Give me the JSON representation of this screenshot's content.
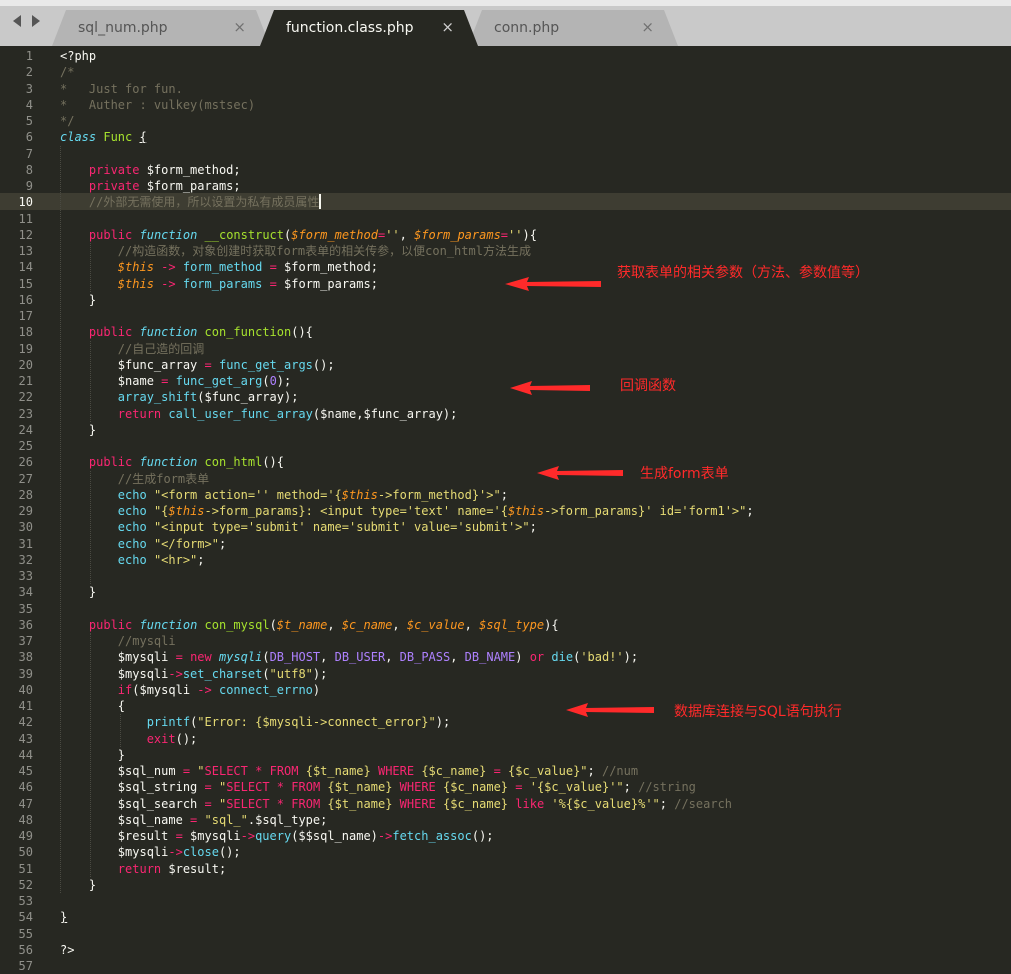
{
  "tabs": [
    {
      "label": "sql_num.php",
      "close": "×",
      "active": false
    },
    {
      "label": "function.class.php",
      "close": "×",
      "active": true
    },
    {
      "label": "conn.php",
      "close": "×",
      "active": false
    }
  ],
  "editor": {
    "current_line": 10,
    "lines": [
      [
        [
          "p",
          "<?php"
        ]
      ],
      [
        [
          "c",
          "/*"
        ]
      ],
      [
        [
          "c",
          "*   Just for fun."
        ]
      ],
      [
        [
          "c",
          "*   Auther : vulkey(mstsec)"
        ]
      ],
      [
        [
          "c",
          "*/"
        ]
      ],
      [
        [
          "st",
          "class"
        ],
        [
          "p",
          " "
        ],
        [
          "f",
          "Func"
        ],
        [
          "p",
          " "
        ],
        [
          "pu",
          "{"
        ]
      ],
      [],
      [
        [
          "p",
          "    "
        ],
        [
          "k",
          "private"
        ],
        [
          "p",
          " $form_method;"
        ]
      ],
      [
        [
          "p",
          "    "
        ],
        [
          "k",
          "private"
        ],
        [
          "p",
          " $form_params;"
        ]
      ],
      [
        [
          "p",
          "    "
        ],
        [
          "c",
          "//外部无需使用，所以设置为私有成员属性"
        ]
      ],
      [],
      [
        [
          "p",
          "    "
        ],
        [
          "k",
          "public"
        ],
        [
          "p",
          " "
        ],
        [
          "st",
          "function"
        ],
        [
          "p",
          " "
        ],
        [
          "f",
          "__construct"
        ],
        [
          "p",
          "("
        ],
        [
          "t",
          "$form_method"
        ],
        [
          "k",
          "="
        ],
        [
          "s",
          "''"
        ],
        [
          "p",
          ", "
        ],
        [
          "t",
          "$form_params"
        ],
        [
          "k",
          "="
        ],
        [
          "s",
          "''"
        ],
        [
          "p",
          "){"
        ]
      ],
      [
        [
          "p",
          "        "
        ],
        [
          "c",
          "//构造函数，对象创建时获取form表单的相关传参，以便con_html方法生成"
        ]
      ],
      [
        [
          "p",
          "        "
        ],
        [
          "t",
          "$this"
        ],
        [
          "p",
          " "
        ],
        [
          "k",
          "->"
        ],
        [
          "p",
          " "
        ],
        [
          "m",
          "form_method"
        ],
        [
          "p",
          " "
        ],
        [
          "k",
          "="
        ],
        [
          "p",
          " $form_method;"
        ]
      ],
      [
        [
          "p",
          "        "
        ],
        [
          "t",
          "$this"
        ],
        [
          "p",
          " "
        ],
        [
          "k",
          "->"
        ],
        [
          "p",
          " "
        ],
        [
          "m",
          "form_params"
        ],
        [
          "p",
          " "
        ],
        [
          "k",
          "="
        ],
        [
          "p",
          " $form_params;"
        ]
      ],
      [
        [
          "p",
          "    }"
        ]
      ],
      [],
      [
        [
          "p",
          "    "
        ],
        [
          "k",
          "public"
        ],
        [
          "p",
          " "
        ],
        [
          "st",
          "function"
        ],
        [
          "p",
          " "
        ],
        [
          "f",
          "con_function"
        ],
        [
          "p",
          "(){"
        ]
      ],
      [
        [
          "p",
          "        "
        ],
        [
          "c",
          "//自己造的回调"
        ]
      ],
      [
        [
          "p",
          "        $func_array "
        ],
        [
          "k",
          "="
        ],
        [
          "p",
          " "
        ],
        [
          "m",
          "func_get_args"
        ],
        [
          "p",
          "();"
        ]
      ],
      [
        [
          "p",
          "        $name "
        ],
        [
          "k",
          "="
        ],
        [
          "p",
          " "
        ],
        [
          "m",
          "func_get_arg"
        ],
        [
          "p",
          "("
        ],
        [
          "n",
          "0"
        ],
        [
          "p",
          ");"
        ]
      ],
      [
        [
          "p",
          "        "
        ],
        [
          "m",
          "array_shift"
        ],
        [
          "p",
          "($func_array);"
        ]
      ],
      [
        [
          "p",
          "        "
        ],
        [
          "k",
          "return"
        ],
        [
          "p",
          " "
        ],
        [
          "m",
          "call_user_func_array"
        ],
        [
          "p",
          "($name,$func_array);"
        ]
      ],
      [
        [
          "p",
          "    }"
        ]
      ],
      [],
      [
        [
          "p",
          "    "
        ],
        [
          "k",
          "public"
        ],
        [
          "p",
          " "
        ],
        [
          "st",
          "function"
        ],
        [
          "p",
          " "
        ],
        [
          "f",
          "con_html"
        ],
        [
          "p",
          "(){"
        ]
      ],
      [
        [
          "p",
          "        "
        ],
        [
          "c",
          "//生成form表单"
        ]
      ],
      [
        [
          "p",
          "        "
        ],
        [
          "m",
          "echo"
        ],
        [
          "p",
          " "
        ],
        [
          "s",
          "\"<form action='' method='{"
        ],
        [
          "t",
          "$this"
        ],
        [
          "s",
          "->form_method}'>\""
        ],
        [
          "p",
          ";"
        ]
      ],
      [
        [
          "p",
          "        "
        ],
        [
          "m",
          "echo"
        ],
        [
          "p",
          " "
        ],
        [
          "s",
          "\"{"
        ],
        [
          "t",
          "$this"
        ],
        [
          "s",
          "->form_params}: <input type='text' name='{"
        ],
        [
          "t",
          "$this"
        ],
        [
          "s",
          "->form_params}' id='form1'>\""
        ],
        [
          "p",
          ";"
        ]
      ],
      [
        [
          "p",
          "        "
        ],
        [
          "m",
          "echo"
        ],
        [
          "p",
          " "
        ],
        [
          "s",
          "\"<input type='submit' name='submit' value='submit'>\""
        ],
        [
          "p",
          ";"
        ]
      ],
      [
        [
          "p",
          "        "
        ],
        [
          "m",
          "echo"
        ],
        [
          "p",
          " "
        ],
        [
          "s",
          "\"</form>\""
        ],
        [
          "p",
          ";"
        ]
      ],
      [
        [
          "p",
          "        "
        ],
        [
          "m",
          "echo"
        ],
        [
          "p",
          " "
        ],
        [
          "s",
          "\"<hr>\""
        ],
        [
          "p",
          ";"
        ]
      ],
      [],
      [
        [
          "p",
          "    }"
        ]
      ],
      [],
      [
        [
          "p",
          "    "
        ],
        [
          "k",
          "public"
        ],
        [
          "p",
          " "
        ],
        [
          "st",
          "function"
        ],
        [
          "p",
          " "
        ],
        [
          "f",
          "con_mysql"
        ],
        [
          "p",
          "("
        ],
        [
          "t",
          "$t_name"
        ],
        [
          "p",
          ", "
        ],
        [
          "t",
          "$c_name"
        ],
        [
          "p",
          ", "
        ],
        [
          "t",
          "$c_value"
        ],
        [
          "p",
          ", "
        ],
        [
          "t",
          "$sql_type"
        ],
        [
          "p",
          "){"
        ]
      ],
      [
        [
          "p",
          "        "
        ],
        [
          "c",
          "//mysqli"
        ]
      ],
      [
        [
          "p",
          "        $mysqli "
        ],
        [
          "k",
          "="
        ],
        [
          "p",
          " "
        ],
        [
          "k",
          "new"
        ],
        [
          "p",
          " "
        ],
        [
          "st",
          "mysqli"
        ],
        [
          "p",
          "("
        ],
        [
          "cn",
          "DB_HOST"
        ],
        [
          "p",
          ", "
        ],
        [
          "cn",
          "DB_USER"
        ],
        [
          "p",
          ", "
        ],
        [
          "cn",
          "DB_PASS"
        ],
        [
          "p",
          ", "
        ],
        [
          "cn",
          "DB_NAME"
        ],
        [
          "p",
          ") "
        ],
        [
          "k",
          "or"
        ],
        [
          "p",
          " "
        ],
        [
          "m",
          "die"
        ],
        [
          "p",
          "("
        ],
        [
          "s",
          "'bad!'"
        ],
        [
          "p",
          ");"
        ]
      ],
      [
        [
          "p",
          "        $mysqli"
        ],
        [
          "k",
          "->"
        ],
        [
          "m",
          "set_charset"
        ],
        [
          "p",
          "("
        ],
        [
          "s",
          "\"utf8\""
        ],
        [
          "p",
          ");"
        ]
      ],
      [
        [
          "p",
          "        "
        ],
        [
          "k",
          "if"
        ],
        [
          "p",
          "($mysqli "
        ],
        [
          "k",
          "->"
        ],
        [
          "p",
          " "
        ],
        [
          "m",
          "connect_errno"
        ],
        [
          "p",
          ")"
        ]
      ],
      [
        [
          "p",
          "        {"
        ]
      ],
      [
        [
          "p",
          "            "
        ],
        [
          "m",
          "printf"
        ],
        [
          "p",
          "("
        ],
        [
          "s",
          "\"Error: {$mysqli->connect_error}\""
        ],
        [
          "p",
          ");"
        ]
      ],
      [
        [
          "p",
          "            "
        ],
        [
          "k",
          "exit"
        ],
        [
          "p",
          "();"
        ]
      ],
      [
        [
          "p",
          "        }"
        ]
      ],
      [
        [
          "p",
          "        $sql_num "
        ],
        [
          "k",
          "="
        ],
        [
          "p",
          " "
        ],
        [
          "s",
          "\""
        ],
        [
          "k",
          "SELECT"
        ],
        [
          "s",
          " "
        ],
        [
          "k",
          "*"
        ],
        [
          "s",
          " "
        ],
        [
          "k",
          "FROM"
        ],
        [
          "s",
          " {$t_name} "
        ],
        [
          "k",
          "WHERE"
        ],
        [
          "s",
          " {$c_name} "
        ],
        [
          "k",
          "="
        ],
        [
          "s",
          " {$c_value}\""
        ],
        [
          "p",
          "; "
        ],
        [
          "c",
          "//num"
        ]
      ],
      [
        [
          "p",
          "        $sql_string "
        ],
        [
          "k",
          "="
        ],
        [
          "p",
          " "
        ],
        [
          "s",
          "\""
        ],
        [
          "k",
          "SELECT"
        ],
        [
          "s",
          " "
        ],
        [
          "k",
          "*"
        ],
        [
          "s",
          " "
        ],
        [
          "k",
          "FROM"
        ],
        [
          "s",
          " {$t_name} "
        ],
        [
          "k",
          "WHERE"
        ],
        [
          "s",
          " {$c_name} "
        ],
        [
          "k",
          "="
        ],
        [
          "s",
          " '{$c_value}'\""
        ],
        [
          "p",
          "; "
        ],
        [
          "c",
          "//string"
        ]
      ],
      [
        [
          "p",
          "        $sql_search "
        ],
        [
          "k",
          "="
        ],
        [
          "p",
          " "
        ],
        [
          "s",
          "\""
        ],
        [
          "k",
          "SELECT"
        ],
        [
          "s",
          " "
        ],
        [
          "k",
          "*"
        ],
        [
          "s",
          " "
        ],
        [
          "k",
          "FROM"
        ],
        [
          "s",
          " {$t_name} "
        ],
        [
          "k",
          "WHERE"
        ],
        [
          "s",
          " {$c_name} "
        ],
        [
          "k",
          "like"
        ],
        [
          "s",
          " '%{$c_value}%'\""
        ],
        [
          "p",
          "; "
        ],
        [
          "c",
          "//search"
        ]
      ],
      [
        [
          "p",
          "        $sql_name "
        ],
        [
          "k",
          "="
        ],
        [
          "p",
          " "
        ],
        [
          "s",
          "\"sql_\""
        ],
        [
          "p",
          "."
        ],
        [
          "p",
          "$sql_type;"
        ]
      ],
      [
        [
          "p",
          "        $result "
        ],
        [
          "k",
          "="
        ],
        [
          "p",
          " $mysqli"
        ],
        [
          "k",
          "->"
        ],
        [
          "m",
          "query"
        ],
        [
          "p",
          "($$sql_name)"
        ],
        [
          "k",
          "->"
        ],
        [
          "m",
          "fetch_assoc"
        ],
        [
          "p",
          "();"
        ]
      ],
      [
        [
          "p",
          "        $mysqli"
        ],
        [
          "k",
          "->"
        ],
        [
          "m",
          "close"
        ],
        [
          "p",
          "();"
        ]
      ],
      [
        [
          "p",
          "        "
        ],
        [
          "k",
          "return"
        ],
        [
          "p",
          " $result;"
        ]
      ],
      [
        [
          "p",
          "    }"
        ]
      ],
      [],
      [
        [
          "pu",
          "}"
        ]
      ],
      [],
      [
        [
          "p",
          "?>"
        ]
      ],
      []
    ]
  },
  "annotations": [
    {
      "text": "获取表单的相关参数（方法、参数值等）"
    },
    {
      "text": "回调函数"
    },
    {
      "text": "生成form表单"
    },
    {
      "text": "数据库连接与SQL语句执行"
    }
  ],
  "colors": {
    "background": "#272822",
    "annotation": "#ff2a2a",
    "keyword": "#f92672",
    "string": "#e6db74",
    "comment": "#75715e"
  }
}
